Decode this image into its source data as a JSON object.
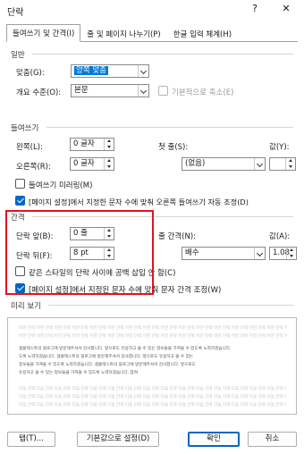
{
  "window": {
    "title": "단락",
    "help": "?",
    "close": "✕"
  },
  "tabs": [
    {
      "label": "들여쓰기 및 간격(I)"
    },
    {
      "label": "줄 및 페이지 나누기(P)"
    },
    {
      "label": "한글 입력 체계(H)"
    }
  ],
  "general": {
    "header": "일반",
    "alignment_label": "맞춤(G):",
    "alignment_value": "양쪽 맞춤",
    "outline_label": "개요 수준(O):",
    "outline_value": "본문",
    "collapsed_label": "기본적으로 축소(E)"
  },
  "indent": {
    "header": "들여쓰기",
    "left_label": "왼쪽(L):",
    "left_value": "0 글자",
    "right_label": "오른쪽(R):",
    "right_value": "0 글자",
    "special_label": "첫 줄(S):",
    "special_value": "(없음)",
    "by_label": "값(Y):",
    "by_value": "",
    "mirror_label": "들여쓰기 미러링(M)",
    "auto_adjust_label": "[페이지 설정]에서 지정한 문자 수에 맞춰 오른쪽 들여쓰기 자동 조정(D)"
  },
  "spacing": {
    "header": "간격",
    "before_label": "단락 앞(B):",
    "before_value": "0 줄",
    "after_label": "단락 뒤(F):",
    "after_value": "8 pt",
    "line_label": "줄 간격(N):",
    "line_value": "배수",
    "at_label": "값(A):",
    "at_value": "1.08",
    "no_space_label": "같은 스타일의 단락 사이에 공백 삽입 안 함(C)",
    "snap_grid_label": "[페이지 설정]에서 지정된 문자 수에 맞춰 문자 간격 조정(W)"
  },
  "preview": {
    "header": "미리 보기",
    "prev_para": "이전 단락 이전 단락 이전 단락 이전 단락 이전 단락 이전 단락 이전 단락 이전 단락 이전 단락 이전 단락 이전 단락 이전 단락 이전 단락 이전 단락 이전 단락 이전 단락",
    "sample_1": "샘플텍스트의 블로그에 방문해주셔서 감사합니다. 앞으로도 유용하고 쓸 수 있는 정보들을 가져올 수 있도록 노력하겠습니다.",
    "sample_2": "도록 노력하겠습니다. 샘플텍스트의 블로그에 방문해주셔서 감사합니다. 앞으로도 유용하고 쓸 수 있는",
    "sample_3": "정보들을 가져올 수 있도록 노력하겠습니다. 샘플텍스트의 블로그에 방문해주셔서 감사합니다. 앞으로도",
    "sample_4": "유용하고 쓸 수 있는 정보들을 가져올 수 있도록 노력하겠습니다. 참여",
    "next_para": "다음 단락 다음 단락 다음 단락 다음 단락 다음 단락 다음 단락 다음 단락 다음 단락 다음 단락 다음 단락 다음 단락 다음 단락 다음 단락 다음 단락 다음 단락 다음 단락"
  },
  "buttons": {
    "tabs": "탭(T)...",
    "default": "기본값으로 설정(D)",
    "ok": "확인",
    "cancel": "취소"
  },
  "colors": {
    "accent": "#0067c0",
    "highlight_box": "#e0141e"
  }
}
